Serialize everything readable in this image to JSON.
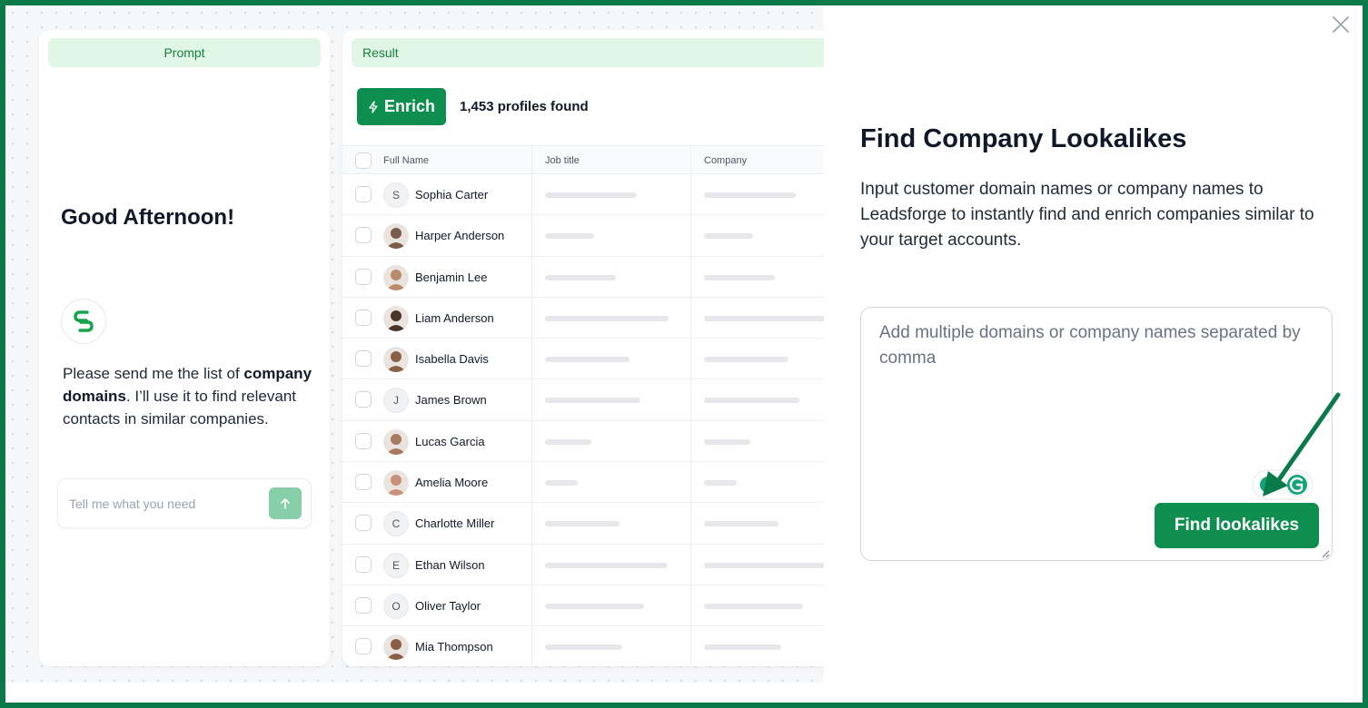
{
  "prompt_panel": {
    "header": "Prompt",
    "greeting": "Good Afternoon!",
    "message_part1": "Please send me the list of ",
    "message_bold": "company domains",
    "message_part2": ". I’ll use it to find relevant contacts in similar companies.",
    "input_placeholder": "Tell me what you need"
  },
  "result_panel": {
    "header": "Result",
    "enrich_label": "Enrich",
    "profiles_found": "1,453 profiles found",
    "columns": [
      "Full Name",
      "Job title",
      "Company"
    ],
    "rows": [
      {
        "name": "Sophia Carter",
        "avatar": "S",
        "avatar_type": "initial",
        "job_skel": 0.65,
        "company_skel": 0.65
      },
      {
        "name": "Harper Anderson",
        "avatar": "photo",
        "avatar_type": "photo",
        "job_skel": 0.35,
        "company_skel": 0.35
      },
      {
        "name": "Benjamin Lee",
        "avatar": "photo",
        "avatar_type": "photo",
        "job_skel": 0.5,
        "company_skel": 0.5
      },
      {
        "name": "Liam Anderson",
        "avatar": "photo",
        "avatar_type": "photo",
        "job_skel": 0.88,
        "company_skel": 0.88
      },
      {
        "name": "Isabella Davis",
        "avatar": "photo",
        "avatar_type": "photo",
        "job_skel": 0.6,
        "company_skel": 0.6
      },
      {
        "name": "James Brown",
        "avatar": "J",
        "avatar_type": "initial",
        "job_skel": 0.68,
        "company_skel": 0.68
      },
      {
        "name": "Lucas Garcia",
        "avatar": "photo",
        "avatar_type": "photo",
        "job_skel": 0.33,
        "company_skel": 0.33
      },
      {
        "name": "Amelia Moore",
        "avatar": "photo",
        "avatar_type": "photo",
        "job_skel": 0.23,
        "company_skel": 0.23
      },
      {
        "name": "Charlotte Miller",
        "avatar": "C",
        "avatar_type": "initial",
        "job_skel": 0.53,
        "company_skel": 0.53
      },
      {
        "name": "Ethan Wilson",
        "avatar": "E",
        "avatar_type": "initial",
        "job_skel": 0.87,
        "company_skel": 0.87
      },
      {
        "name": "Oliver Taylor",
        "avatar": "O",
        "avatar_type": "initial",
        "job_skel": 0.7,
        "company_skel": 0.7
      },
      {
        "name": "Mia Thompson",
        "avatar": "photo",
        "avatar_type": "photo",
        "job_skel": 0.55,
        "company_skel": 0.55
      }
    ]
  },
  "lookalike_panel": {
    "title": "Find Company Lookalikes",
    "description": "Input customer domain names or company names to Leadsforge to instantly find and enrich companies similar to your target accounts.",
    "textarea_placeholder": "Add multiple domains or company names separated by comma",
    "find_button": "Find lookalikes"
  },
  "colors": {
    "brand_green": "#0f8f4f",
    "header_tint": "#e2f6e8",
    "frame_border": "#0b7a4a",
    "annotation_arrow": "#0b7a4a"
  },
  "icons": [
    "bolt-icon",
    "arrow-up-icon",
    "close-icon",
    "brand-logo-icon",
    "grammarly-icon"
  ]
}
